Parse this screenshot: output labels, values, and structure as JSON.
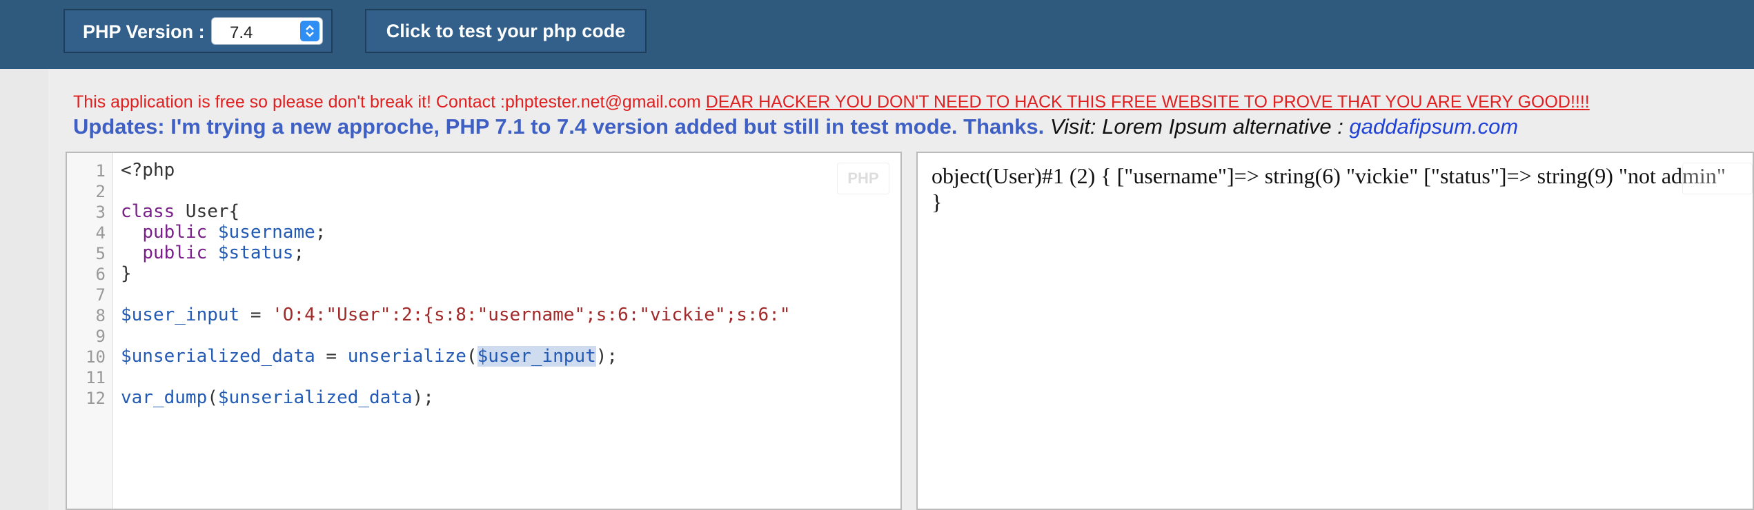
{
  "toolbar": {
    "version_label": "PHP Version :",
    "version_value": "7.4",
    "test_button_label": "Click to test your php code"
  },
  "notice": {
    "text": "This application is free so please don't break it! Contact :phptester.net@gmail.com ",
    "link": "DEAR HACKER YOU DON'T NEED TO HACK THIS FREE WEBSITE TO PROVE THAT YOU ARE VERY GOOD!!!!"
  },
  "updates": {
    "text": "Updates: I'm trying a new approche, PHP 7.1 to 7.4 version added but still in test mode. Thanks.",
    "visit_text": " Visit: Lorem Ipsum alternative : ",
    "visit_link": "gaddafipsum.com"
  },
  "editor": {
    "badge": "PHP",
    "line_numbers": [
      "1",
      "2",
      "3",
      "4",
      "5",
      "6",
      "7",
      "8",
      "9",
      "10",
      "11",
      "12"
    ]
  },
  "output": {
    "text": "object(User)#1 (2) { [\"username\"]=> string(6) \"vickie\" [\"status\"]=> string(9) \"not admin\" }"
  },
  "colors": {
    "header_bg": "#2f5a7e",
    "notice_red": "#e02020",
    "updates_blue": "#3e5fc4"
  }
}
